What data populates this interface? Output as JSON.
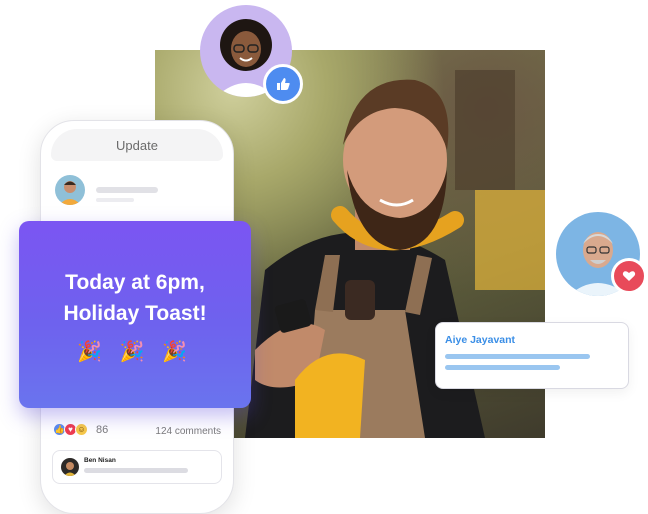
{
  "phone": {
    "header_title": "Update",
    "reaction_count": "86",
    "comments_label": "124 comments",
    "commenter_name": "Ben Nisan"
  },
  "announcement": {
    "line1": "Today at 6pm,",
    "line2": "Holiday Toast!",
    "emojis": "🎉 🎉 🎉"
  },
  "name_card": {
    "name": "Aiye Jayavant"
  },
  "icons": {
    "like_badge": "thumbs-up-icon",
    "heart_badge": "heart-icon"
  },
  "colors": {
    "announcement_top": "#7b55f2",
    "announcement_bottom": "#6a74ee",
    "like_badge": "#4e8cf0",
    "heart_badge": "#e84a5a",
    "name_accent": "#3a8ee6"
  }
}
